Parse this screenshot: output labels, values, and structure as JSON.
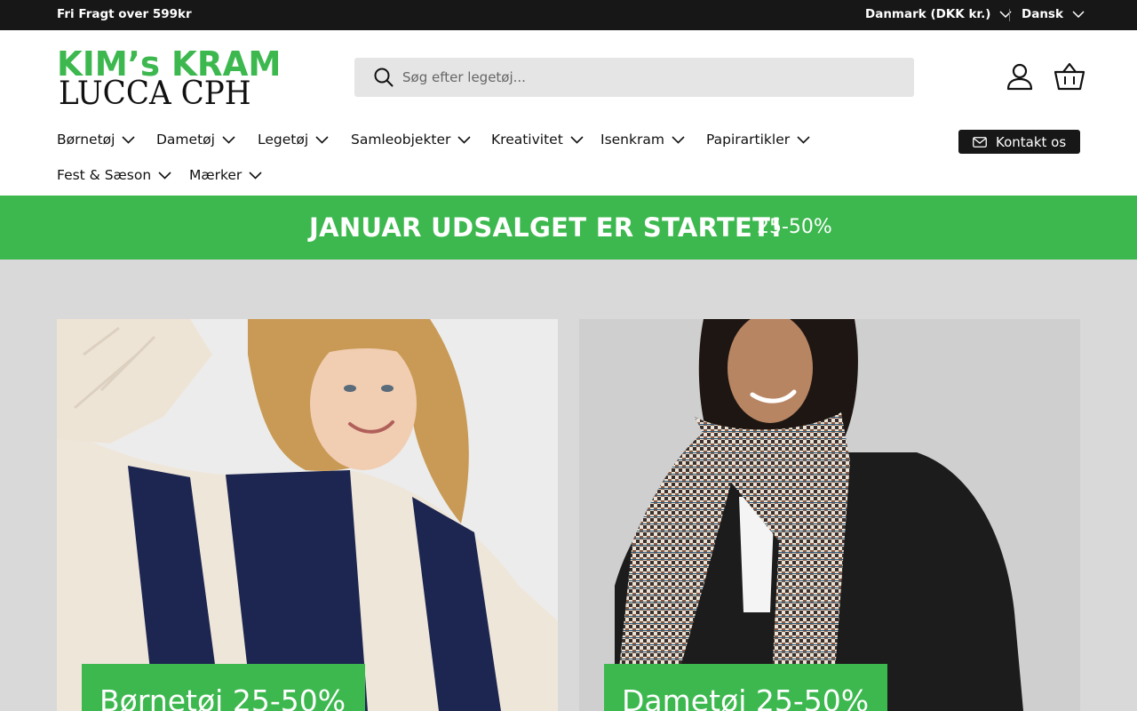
{
  "topbar": {
    "free_shipping": "Fri Fragt over 599kr",
    "country": "Danmark (DKK kr.)",
    "language": "Dansk"
  },
  "logo": {
    "line1": "KIM’s KRAM",
    "line2": "LUCCA CPH"
  },
  "search": {
    "placeholder": "Søg efter legetøj..."
  },
  "nav": {
    "items": [
      {
        "label": "Børnetøj"
      },
      {
        "label": "Dametøj"
      },
      {
        "label": "Legetøj"
      },
      {
        "label": "Samleobjekter"
      },
      {
        "label": "Kreativitet"
      },
      {
        "label": "Isenkram"
      },
      {
        "label": "Papirartikler"
      },
      {
        "label": "Fest & Sæson"
      },
      {
        "label": "Mærker"
      }
    ],
    "contact_label": "Kontakt os"
  },
  "banner": {
    "headline": "JANUAR UDSALGET ER STARTET!",
    "percent": "25-50%"
  },
  "cards": [
    {
      "tag": "Børnetøj 25-50%"
    },
    {
      "tag": "Dametøj 25-50%"
    }
  ],
  "colors": {
    "brand_green": "#3db84f",
    "topbar_bg": "#171717",
    "search_bg": "#e5e5e5"
  },
  "icons": [
    "chevron-down-icon",
    "search-icon",
    "account-icon",
    "basket-icon",
    "mail-icon"
  ]
}
